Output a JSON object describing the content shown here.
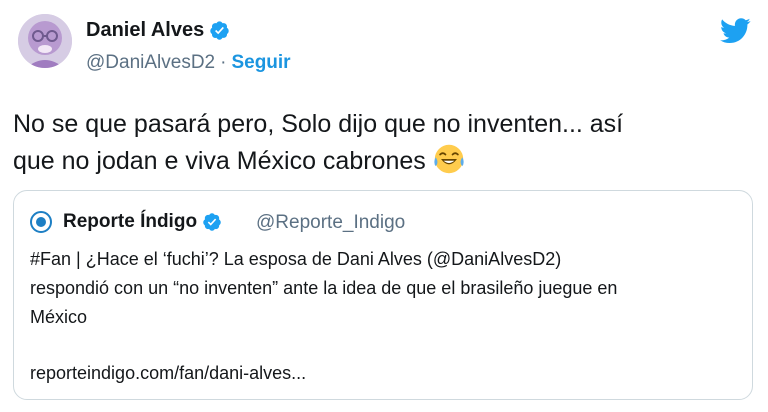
{
  "author": {
    "name": "Daniel Alves",
    "handle": "@DaniAlvesD2",
    "separator": "·",
    "follow_label": "Seguir",
    "avatar_icon": "profile-avatar-icon",
    "verified_icon": "verified-badge-icon"
  },
  "brand": {
    "icon": "twitter-bird-icon",
    "color": "#1da1f2"
  },
  "tweet": {
    "text_line1": "No se que pasará pero, Solo dijo que no inventen... así",
    "text_line2": "que no jodan e viva México cabrones",
    "emoji": "face-with-tears-of-joy-icon"
  },
  "quote": {
    "name": "Reporte Índigo",
    "handle": "@Reporte_Indigo",
    "avatar_icon": "reporte-indigo-logo-icon",
    "text_line1": "#Fan | ¿Hace el ‘fuchi’? La esposa de Dani Alves (@DaniAlvesD2)",
    "text_line2": "respondió con un “no inventen” ante la idea de que el brasileño juegue en",
    "text_line3": "México",
    "link": "reporteindigo.com/fan/dani-alves..."
  },
  "colors": {
    "verified": "#1da1f2",
    "follow": "#1b95e0",
    "secondary_text": "#5b7083",
    "border": "#cfd9de"
  }
}
